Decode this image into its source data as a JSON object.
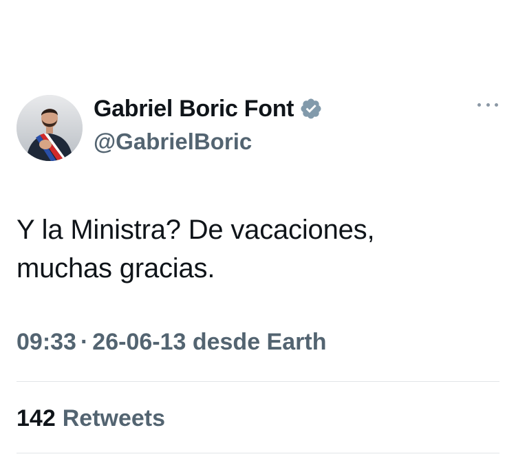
{
  "author": {
    "display_name": "Gabriel Boric Font",
    "handle": "@GabrielBoric",
    "verified_icon": "verified-badge-icon",
    "avatar_icon": "profile-photo"
  },
  "tweet": {
    "text_lines": [
      "Y la Ministra? De vacaciones,",
      "muchas gracias."
    ],
    "time": "09:33",
    "separator": "·",
    "date_source": "26-06-13 desde Earth"
  },
  "stats": {
    "retweets_count": "142",
    "retweets_label": "Retweets"
  },
  "colors": {
    "text": "#0f1419",
    "secondary": "#536471",
    "divider": "#e1e5e8",
    "badge": "#829aab"
  }
}
